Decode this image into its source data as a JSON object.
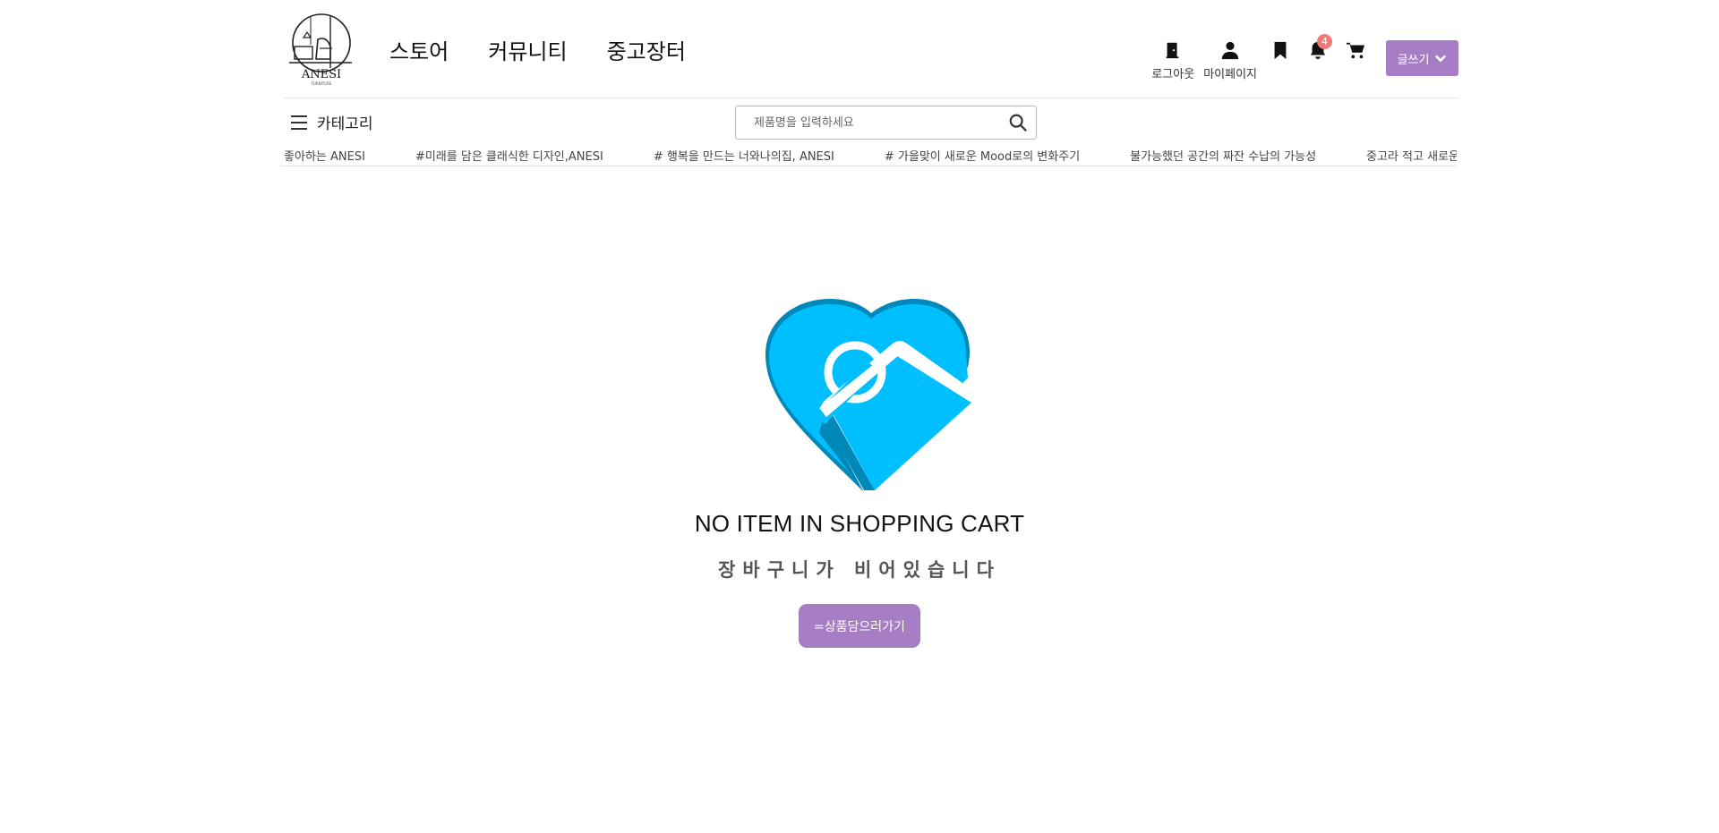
{
  "brand": {
    "logo_text": "ANESI",
    "logo_sub": "FURNITURE"
  },
  "nav": {
    "items": [
      {
        "label": "스토어"
      },
      {
        "label": "커뮤니티"
      },
      {
        "label": "중고장터"
      }
    ]
  },
  "util": {
    "logout_label": "로그아웃",
    "mypage_label": "마이페이지",
    "notification_count": "4",
    "write_label": "글쓰기"
  },
  "category": {
    "label": "카테고리"
  },
  "search": {
    "placeholder": "제품명을 입력하세요"
  },
  "ticker": {
    "items": [
      "치도 좋아하는 ANESI",
      "#미래를 담은 클래식한 디자인,ANESI",
      "# 행복을 만드는 너와나의집, ANESI",
      "# 가을맞이 새로운 Mood로의 변화주기",
      "불가능했던 공간의 짜잔 수납의 가능성",
      "중고라 적고 새로운 트렌드라"
    ]
  },
  "empty_cart": {
    "title": "NO ITEM IN SHOPPING CART",
    "subtitle": "장바구니가 비어있습니다",
    "button_label": "=상품담으러가기"
  },
  "colors": {
    "accent": "#a77ec6",
    "badge": "#f07b7b",
    "heart": "#00bfff",
    "heart_dark": "#0088b8"
  }
}
